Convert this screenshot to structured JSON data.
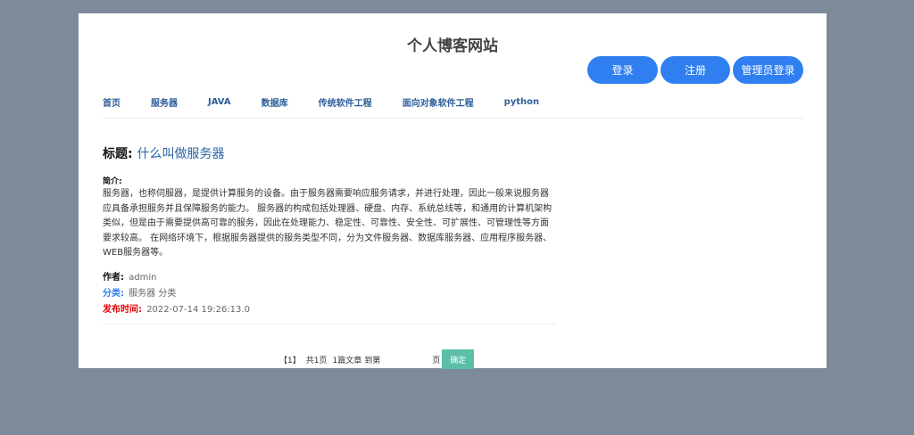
{
  "site": {
    "title": "个人博客网站"
  },
  "auth": {
    "login": "登录",
    "register": "注册",
    "admin_login": "管理员登录"
  },
  "nav": {
    "items": [
      "首页",
      "服务器",
      "JAVA",
      "数据库",
      "传统软件工程",
      "面向对象软件工程",
      "python"
    ]
  },
  "article": {
    "title_label": "标题:",
    "title": "什么叫做服务器",
    "summary_label": "简介:",
    "summary": "服务器，也称伺服器，是提供计算服务的设备。由于服务器需要响应服务请求，并进行处理，因此一般来说服务器应具备承担服务并且保障服务的能力。 服务器的构成包括处理器、硬盘、内存、系统总线等，和通用的计算机架构类似，但是由于需要提供高可靠的服务，因此在处理能力、稳定性、可靠性、安全性、可扩展性、可管理性等方面要求较高。 在网络环境下，根据服务器提供的服务类型不同，分为文件服务器、数据库服务器、应用程序服务器、WEB服务器等。",
    "author_label": "作者:",
    "author": "admin",
    "category_label": "分类:",
    "category": "服务器 分类",
    "time_label": "发布时间:",
    "time": "2022-07-14 19:26:13.0"
  },
  "pager": {
    "current": "【1】",
    "total_pages": "共1页",
    "total_articles": "1篇文章",
    "goto_label": "到第",
    "page_suffix": "页",
    "confirm": "确定"
  }
}
